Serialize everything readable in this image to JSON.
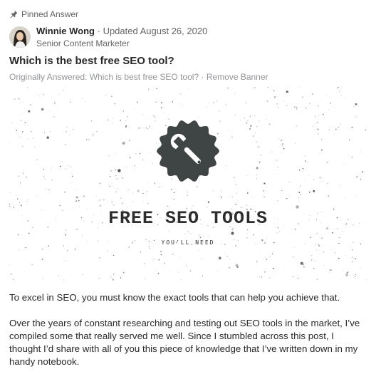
{
  "pinned_label": "Pinned Answer",
  "author": {
    "name": "Winnie Wong",
    "separator": "·",
    "updated": "Updated August 26, 2020",
    "credential": "Senior Content Marketer"
  },
  "question": "Which is the best free SEO tool?",
  "originally_answered": {
    "text": "Originally Answered: Which is best free SEO tool?",
    "separator": "·",
    "action": "Remove Banner"
  },
  "banner": {
    "title": "FREE SEO TOOLS",
    "subtitle": "YOU'LL NEED",
    "icon": "wrench-icon",
    "badge_color": "#3f4545"
  },
  "body": [
    "To excel in SEO, you must know the exact tools that can help you achieve that.",
    "Over the years of constant researching and testing out SEO tools in the market, I’ve compiled some that really served me well. Since I stumbled across this post, I thought I’d share with all of you this piece of knowledge that I’ve written down in my handy notebook."
  ],
  "colors": {
    "text": "#282829",
    "muted": "#636466",
    "faint": "#939598"
  }
}
